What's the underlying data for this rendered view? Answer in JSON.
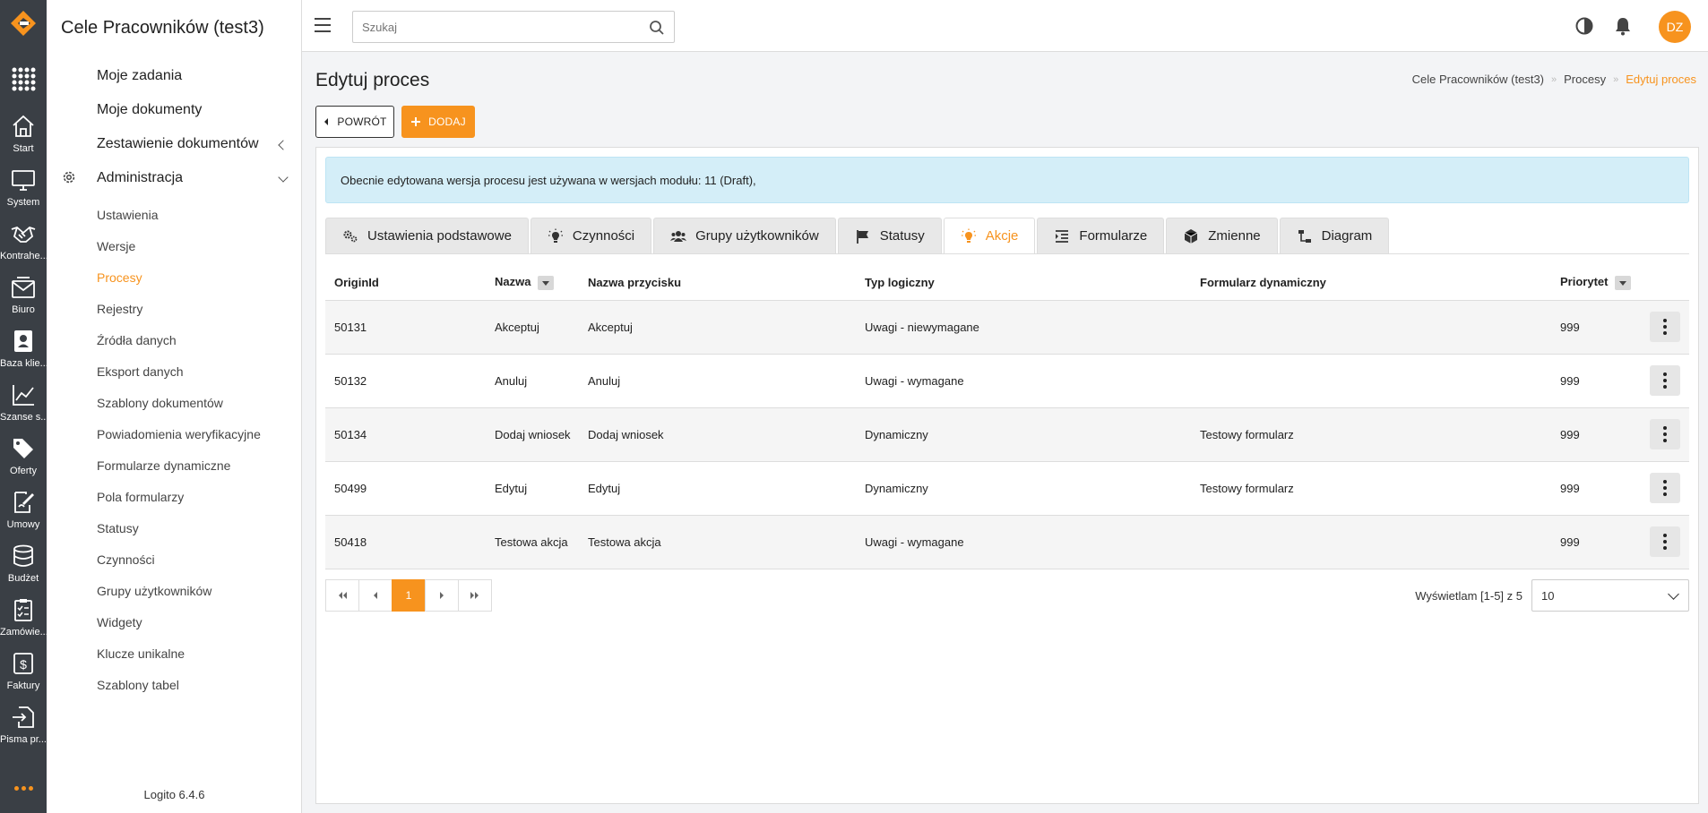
{
  "rail": {
    "items": [
      {
        "label": "Start",
        "icon": "home-icon"
      },
      {
        "label": "System",
        "icon": "monitor-icon"
      },
      {
        "label": "Kontrahe...",
        "icon": "handshake-icon"
      },
      {
        "label": "Biuro",
        "icon": "mail-box-icon"
      },
      {
        "label": "Baza klie...",
        "icon": "contact-card-icon"
      },
      {
        "label": "Szanse s...",
        "icon": "chart-line-icon"
      },
      {
        "label": "Oferty",
        "icon": "tag-icon"
      },
      {
        "label": "Umowy",
        "icon": "sign-document-icon"
      },
      {
        "label": "Budżet",
        "icon": "database-icon"
      },
      {
        "label": "Zamówie...",
        "icon": "clipboard-check-icon"
      },
      {
        "label": "Faktury",
        "icon": "dollar-document-icon"
      },
      {
        "label": "Pisma pr...",
        "icon": "file-import-icon"
      }
    ]
  },
  "sidebar": {
    "title": "Cele Pracowników (test3)",
    "main_items": [
      {
        "label": "Moje zadania"
      },
      {
        "label": "Moje dokumenty"
      },
      {
        "label": "Zestawienie dokumentów"
      },
      {
        "label": "Administracja"
      }
    ],
    "sub_items": [
      {
        "label": "Ustawienia"
      },
      {
        "label": "Wersje"
      },
      {
        "label": "Procesy"
      },
      {
        "label": "Rejestry"
      },
      {
        "label": "Źródła danych"
      },
      {
        "label": "Eksport danych"
      },
      {
        "label": "Szablony dokumentów"
      },
      {
        "label": "Powiadomienia weryfikacyjne"
      },
      {
        "label": "Formularze dynamiczne"
      },
      {
        "label": "Pola formularzy"
      },
      {
        "label": "Statusy"
      },
      {
        "label": "Czynności"
      },
      {
        "label": "Grupy użytkowników"
      },
      {
        "label": "Widgety"
      },
      {
        "label": "Klucze unikalne"
      },
      {
        "label": "Szablony tabel"
      }
    ],
    "active_sub": "Procesy",
    "footer": "Logito 6.4.6"
  },
  "topbar": {
    "search_placeholder": "Szukaj",
    "avatar_initials": "DZ"
  },
  "page": {
    "title": "Edytuj proces",
    "breadcrumb": [
      "Cele Pracowników (test3)",
      "Procesy",
      "Edytuj proces"
    ],
    "back_label": "POWRÓT",
    "add_label": "DODAJ",
    "alert": "Obecnie edytowana wersja procesu jest używana w wersjach modułu: 11 (Draft),"
  },
  "tabs": [
    {
      "label": "Ustawienia podstawowe",
      "icon": "cogs-icon"
    },
    {
      "label": "Czynności",
      "icon": "lightbulb-icon"
    },
    {
      "label": "Grupy użytkowników",
      "icon": "users-icon"
    },
    {
      "label": "Statusy",
      "icon": "flag-icon"
    },
    {
      "label": "Akcje",
      "icon": "lightbulb-icon",
      "active": true
    },
    {
      "label": "Formularze",
      "icon": "list-indent-icon"
    },
    {
      "label": "Zmienne",
      "icon": "cube-icon"
    },
    {
      "label": "Diagram",
      "icon": "diagram-icon"
    }
  ],
  "table": {
    "columns": [
      "OriginId",
      "Nazwa",
      "Nazwa przycisku",
      "Typ logiczny",
      "Formularz dynamiczny",
      "Priorytet"
    ],
    "rows": [
      [
        "50131",
        "Akceptuj",
        "Akceptuj",
        "Uwagi - niewymagane",
        "",
        "999"
      ],
      [
        "50132",
        "Anuluj",
        "Anuluj",
        "Uwagi - wymagane",
        "",
        "999"
      ],
      [
        "50134",
        "Dodaj wniosek",
        "Dodaj wniosek",
        "Dynamiczny",
        "Testowy formularz",
        "999"
      ],
      [
        "50499",
        "Edytuj",
        "Edytuj",
        "Dynamiczny",
        "Testowy formularz",
        "999"
      ],
      [
        "50418",
        "Testowa akcja",
        "Testowa akcja",
        "Uwagi - wymagane",
        "",
        "999"
      ]
    ]
  },
  "pagination": {
    "current_page": "1",
    "showing": "Wyświetlam [1-5] z 5",
    "page_size": "10"
  },
  "colors": {
    "accent": "#f7931e",
    "rail_bg": "#3a3f45",
    "alert_bg": "#d4eef8"
  }
}
